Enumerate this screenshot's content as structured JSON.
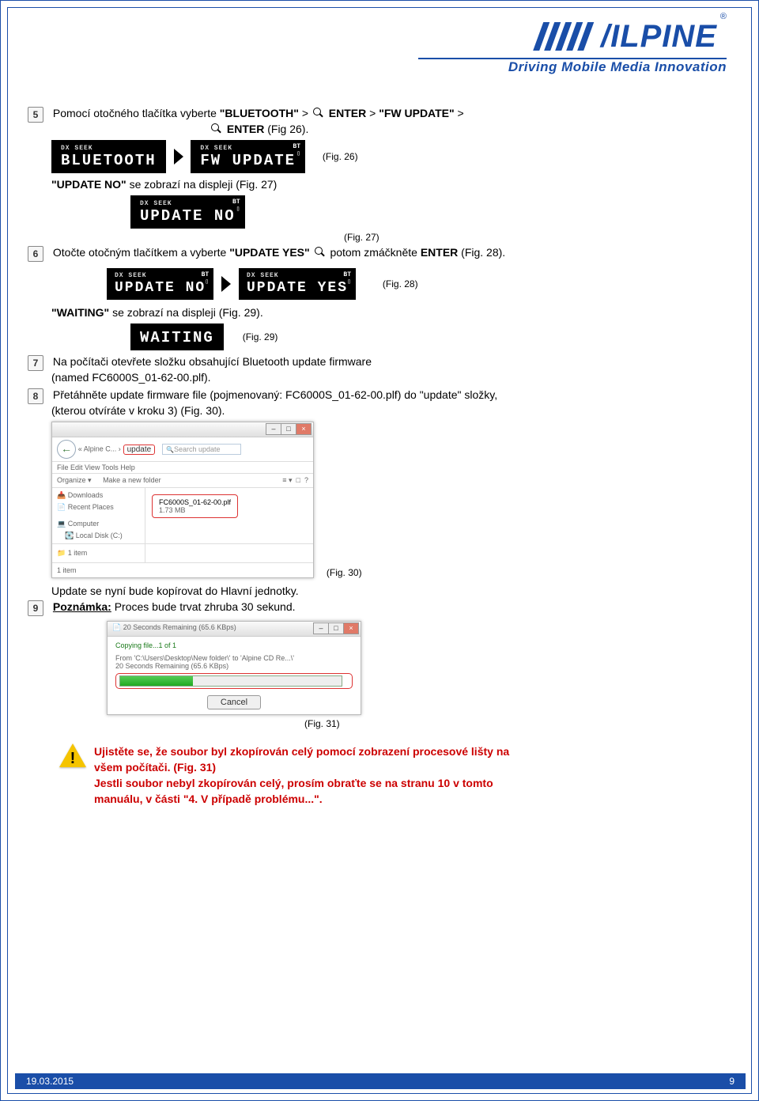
{
  "logo": {
    "brand": "/ILPINE",
    "tagline": "Driving Mobile Media Innovation",
    "reg": "®"
  },
  "steps": {
    "s5": {
      "num": "5",
      "t1": "Pomocí otočného tlačítka vyberte ",
      "bt": "\"BLUETOOTH\"",
      "gt1": " > ",
      "enter1": "ENTER",
      "gt2": " > ",
      "fw": "\"FW UPDATE\"",
      "gt3": " > ",
      "enter2": "ENTER",
      "tail": " (Fig 26)."
    },
    "lcd_bt": {
      "sub": "DX  SEEK",
      "main": "BLUETOOTH",
      "rl1": "BT",
      "rl2": "▯"
    },
    "lcd_fw": {
      "sub": "DX  SEEK",
      "main": "FW UPDATE",
      "rl1": "BT",
      "rl2": "▯"
    },
    "cap26": "(Fig. 26)",
    "upd_no_line": {
      "b": "\"UPDATE NO\"",
      "rest": " se zobrazí na displeji  (Fig. 27)"
    },
    "lcd_upd_no": {
      "sub": "DX  SEEK",
      "main": "UPDATE   NO",
      "rl1": "BT",
      "rl2": "▯"
    },
    "cap27": "(Fig. 27)",
    "s6": {
      "num": "6",
      "t1": "Otočte otočným tlačítkem a vyberte ",
      "b": "\"UPDATE YES\" ",
      "mid": "potom zmáčkněte ",
      "enter": "ENTER",
      "tail": " (Fig. 28)."
    },
    "lcd_upd_no2": {
      "sub": "DX  SEEK",
      "main": "UPDATE   NO",
      "rl1": "BT",
      "rl2": "▯"
    },
    "lcd_upd_yes": {
      "sub": "DX  SEEK",
      "main": "UPDATE  YES",
      "rl1": "BT",
      "rl2": "▯"
    },
    "cap28": "(Fig. 28)",
    "waiting": {
      "b": "\"WAITING\"",
      "rest": " se zobrazí na displeji (Fig. 29)."
    },
    "lcd_wait": {
      "main": "WAITING"
    },
    "cap29": "(Fig. 29)",
    "s7": {
      "num": "7",
      "l1": "Na počítači otevřete složku obsahující Bluetooth update firmware",
      "l2": "(named FC6000S_01-62-00.plf)."
    },
    "s8": {
      "num": "8",
      "l1": "Přetáhněte update firmware file (pojmenovaný: FC6000S_01-62-00.plf) do \"update\" složky,",
      "l2": "(kterou otvíráte v kroku 3) (Fig. 30)."
    },
    "explorer": {
      "crumb_pre": "« Alpine C...  ›",
      "crumb": "update",
      "search_ph": "Search update",
      "menu": "File   Edit   View   Tools   Help",
      "organize": "Organize ▾",
      "newfolder": "Make a new folder",
      "nav": {
        "downloads": "Downloads",
        "recent": "Recent Places",
        "computer": "Computer",
        "disk": "Local Disk (C:)"
      },
      "fname": "FC6000S_01-62-00.plf",
      "fsize": "1.73 MB",
      "status1": "1 item",
      "status2": "1 item"
    },
    "cap30": "(Fig. 30)",
    "upd_copy": "Update se nyní bude kopírovat do Hlavní jednotky.",
    "s9": {
      "num": "9",
      "b": "Poznámka:",
      "rest": " Proces bude trvat zhruba 30 sekund."
    },
    "copywin": {
      "title": "20 Seconds Remaining (65.6 KBps)",
      "copying": "Copying file...1 of 1",
      "from": "From 'C:\\Users\\Desktop\\New folder\\' to 'Alpine CD Re...\\'",
      "remain": "20 Seconds Remaining (65.6 KBps)",
      "cancel": "Cancel"
    },
    "cap31": "(Fig. 31)",
    "warn": {
      "l1": "Ujistěte se, že soubor byl zkopírován celý pomocí zobrazení procesové lišty na",
      "l2": "všem počítači. (Fig. 31)",
      "l3": "Jestli soubor nebyl zkopírován celý, prosím obraťte se na stranu 10 v tomto",
      "l4": "manuálu, v části \"4. V případě problému...\"."
    }
  },
  "footer": {
    "date": "19.03.2015",
    "page": "9"
  }
}
